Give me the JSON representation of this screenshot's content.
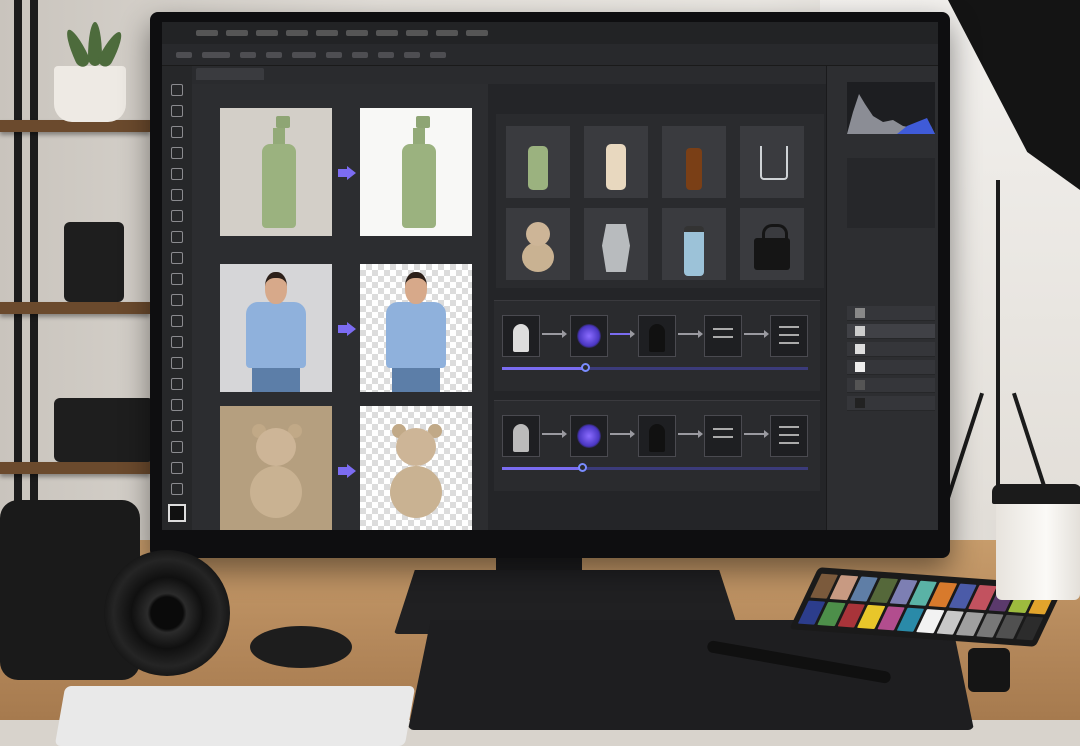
{
  "scene": {
    "description_tag": "monitor-on-desk-photo-editing",
    "colors": {
      "accent": "#7a6cf0",
      "slider_track": "#3b3b7a",
      "app_bg": "#2a2b2e",
      "bottle_green": "#9bb27f",
      "shirt_blue": "#8fb1dc",
      "bear_tan": "#c9b292"
    }
  },
  "editor": {
    "before_after_pairs": [
      {
        "subject": "green-pump-bottle"
      },
      {
        "subject": "woman-in-blue-tshirt"
      },
      {
        "subject": "teddy-bear"
      }
    ],
    "product_grid": [
      "pump-bottle-icon",
      "cream-bottle-icon",
      "amber-dropper-bottle-icon",
      "glass-icon",
      "teddy-bear-icon",
      "moka-pot-icon",
      "tumbler-icon",
      "handbag-icon"
    ],
    "workflows": [
      {
        "nodes": [
          "person-silhouette-icon",
          "glow-blob-icon",
          "mask-icon",
          "adjust-sliders-icon",
          "adjust-sliders-icon"
        ],
        "progress": 0.27
      },
      {
        "nodes": [
          "bust-silhouette-icon",
          "glow-blob-icon",
          "mask-icon",
          "adjust-sliders-icon",
          "adjust-sliders-icon"
        ],
        "progress": 0.26
      }
    ],
    "checker_colors": [
      "#7b5a3c",
      "#c89a82",
      "#5f7ea6",
      "#55683a",
      "#7d7fb3",
      "#5ab3a6",
      "#d87a2c",
      "#4b5ba8",
      "#c2525f",
      "#5b3a6c",
      "#9dbb3e",
      "#e2a42c",
      "#2c3d8c",
      "#4d8f4a",
      "#a8343a",
      "#e8c62a",
      "#b24d8e",
      "#2a8aa8",
      "#f2f2f2",
      "#c8c8c8",
      "#a0a0a0",
      "#787878",
      "#505050",
      "#2c2c2c"
    ]
  }
}
